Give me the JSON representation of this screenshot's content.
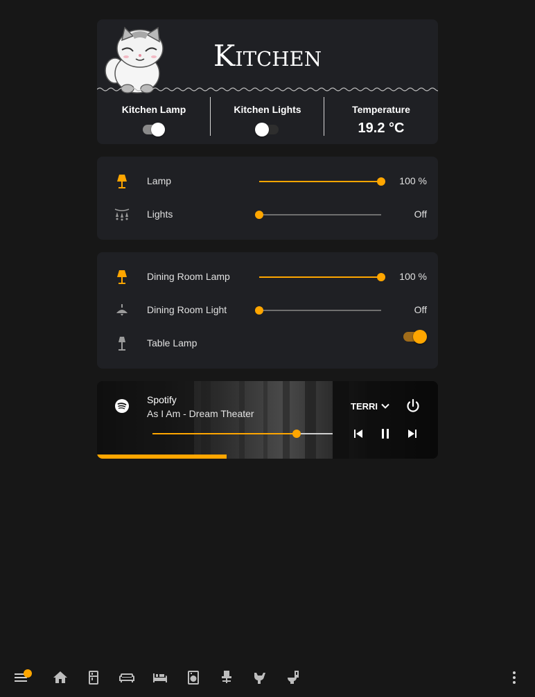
{
  "header": {
    "title": "Kitchen",
    "stats": [
      {
        "label": "Kitchen Lamp",
        "type": "toggle",
        "on": true
      },
      {
        "label": "Kitchen Lights",
        "type": "toggle",
        "on": false
      },
      {
        "label": "Temperature",
        "type": "value",
        "value": "19.2 °C"
      }
    ]
  },
  "group1": [
    {
      "name": "Lamp",
      "icon": "floor-lamp-icon",
      "value": "100 %",
      "level": 1.0,
      "active": true
    },
    {
      "name": "Lights",
      "icon": "string-lights-icon",
      "value": "Off",
      "level": 0.0,
      "active": false
    }
  ],
  "group2": [
    {
      "name": "Dining Room Lamp",
      "icon": "floor-lamp-icon",
      "value": "100 %",
      "level": 1.0,
      "active": true
    },
    {
      "name": "Dining Room Light",
      "icon": "ceiling-light-icon",
      "value": "Off",
      "level": 0.0,
      "active": false
    },
    {
      "name": "Table Lamp",
      "icon": "table-lamp-icon",
      "toggle_on": true,
      "active": false
    }
  ],
  "media": {
    "source": "Spotify",
    "track": "As I Am - Dream Theater",
    "device": "TERRI",
    "volume": 0.8,
    "progress": 0.38
  },
  "nav": {
    "icons": [
      "menu-icon",
      "home-icon",
      "fridge-icon",
      "sofa-icon",
      "bed-icon",
      "washing-machine-icon",
      "desk-chair-icon",
      "toilet-paper-icon",
      "toilet-icon",
      "more-vertical-icon"
    ]
  },
  "colors": {
    "accent": "#ffa600",
    "card": "#1f2024",
    "background": "#171717",
    "inactive_icon": "#9b9b9b"
  }
}
